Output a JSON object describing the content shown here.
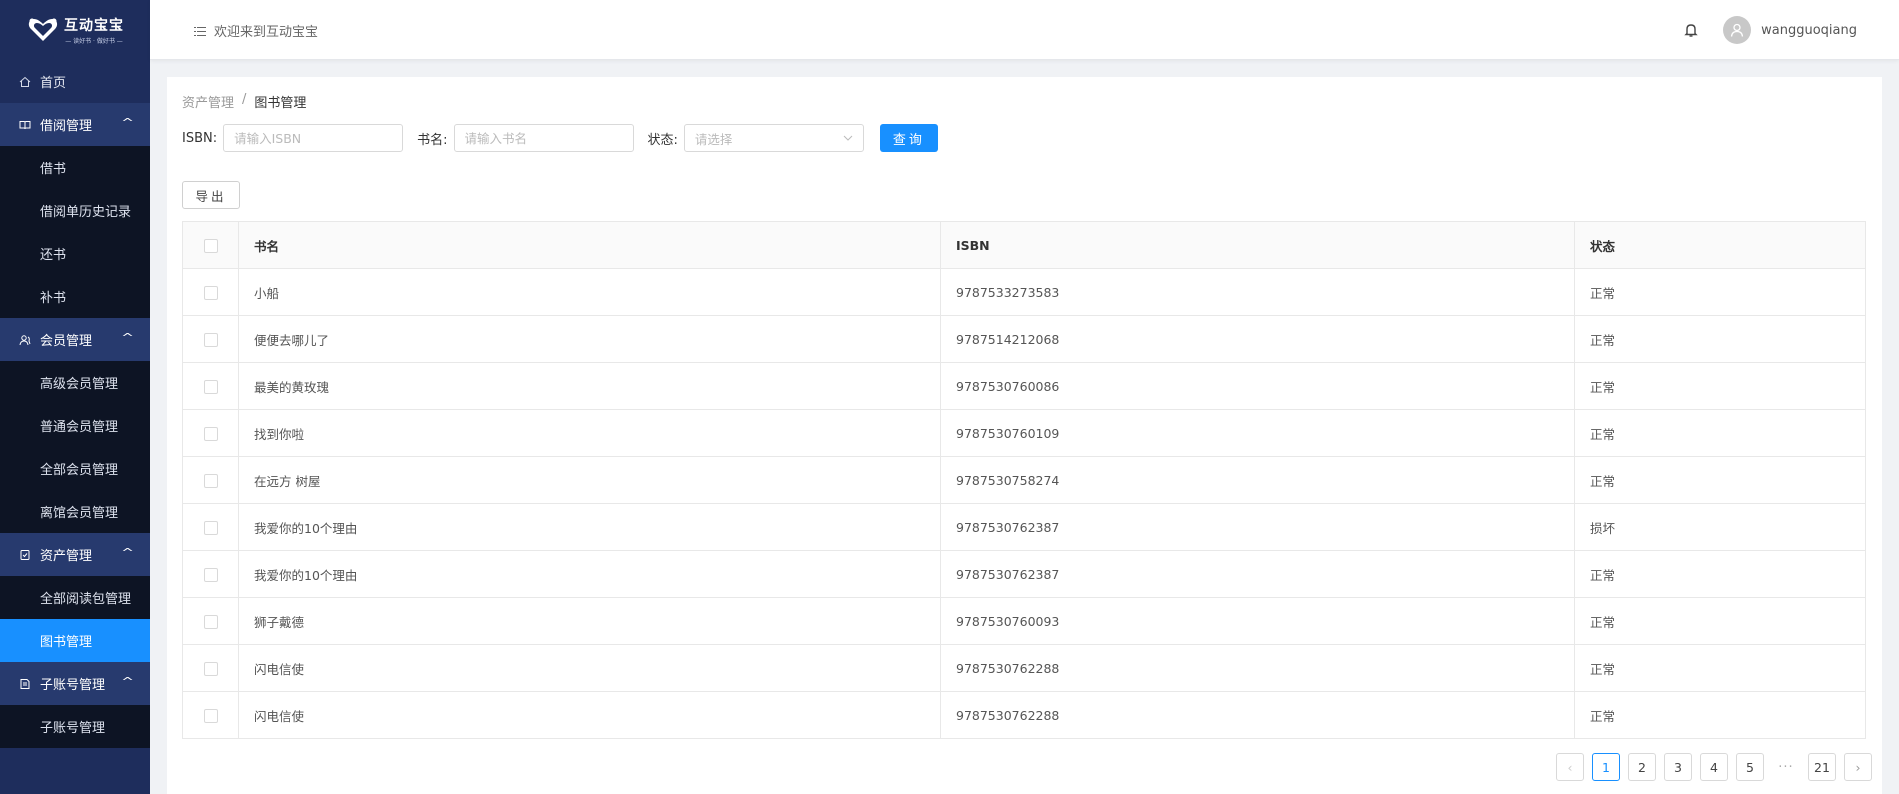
{
  "app": {
    "logo_title": "互动宝宝",
    "logo_subtitle": "— 读好书 · 做好书 —"
  },
  "sidebar": {
    "home": {
      "label": "首页",
      "icon": "home-icon"
    },
    "groups": [
      {
        "label": "借阅管理",
        "icon": "book-icon",
        "items": [
          "借书",
          "借阅单历史记录",
          "还书",
          "补书"
        ]
      },
      {
        "label": "会员管理",
        "icon": "users-icon",
        "items": [
          "高级会员管理",
          "普通会员管理",
          "全部会员管理",
          "离馆会员管理"
        ]
      },
      {
        "label": "资产管理",
        "icon": "asset-icon",
        "items": [
          "全部阅读包管理",
          "图书管理"
        ]
      },
      {
        "label": "子账号管理",
        "icon": "account-icon",
        "items": [
          "子账号管理"
        ]
      }
    ],
    "active_item": "图书管理"
  },
  "header": {
    "welcome": "欢迎来到互动宝宝",
    "username": "wangguoqiang"
  },
  "breadcrumb": [
    "资产管理",
    "图书管理"
  ],
  "filters": {
    "isbn_label": "ISBN:",
    "isbn_placeholder": "请输入ISBN",
    "name_label": "书名:",
    "name_placeholder": "请输入书名",
    "status_label": "状态:",
    "status_placeholder": "请选择",
    "query_button": "查询"
  },
  "export_button": "导出",
  "table": {
    "columns": [
      "书名",
      "ISBN",
      "状态"
    ],
    "rows": [
      {
        "name": "小船",
        "isbn": "9787533273583",
        "status": "正常"
      },
      {
        "name": "便便去哪儿了",
        "isbn": "9787514212068",
        "status": "正常"
      },
      {
        "name": "最美的黄玫瑰",
        "isbn": "9787530760086",
        "status": "正常"
      },
      {
        "name": "找到你啦",
        "isbn": "9787530760109",
        "status": "正常"
      },
      {
        "name": "在远方 树屋",
        "isbn": "9787530758274",
        "status": "正常"
      },
      {
        "name": "我爱你的10个理由",
        "isbn": "9787530762387",
        "status": "损坏"
      },
      {
        "name": "我爱你的10个理由",
        "isbn": "9787530762387",
        "status": "正常"
      },
      {
        "name": "狮子戴德",
        "isbn": "9787530760093",
        "status": "正常"
      },
      {
        "name": "闪电信使",
        "isbn": "9787530762288",
        "status": "正常"
      },
      {
        "name": "闪电信使",
        "isbn": "9787530762288",
        "status": "正常"
      }
    ]
  },
  "pagination": {
    "pages": [
      "1",
      "2",
      "3",
      "4",
      "5"
    ],
    "ellipsis": "···",
    "last_page": "21",
    "current": "1",
    "prev": "‹",
    "next": "›"
  },
  "colors": {
    "sidebar_bg": "#1e2d5c",
    "submenu_bg": "#0d1424",
    "accent": "#1890ff"
  }
}
